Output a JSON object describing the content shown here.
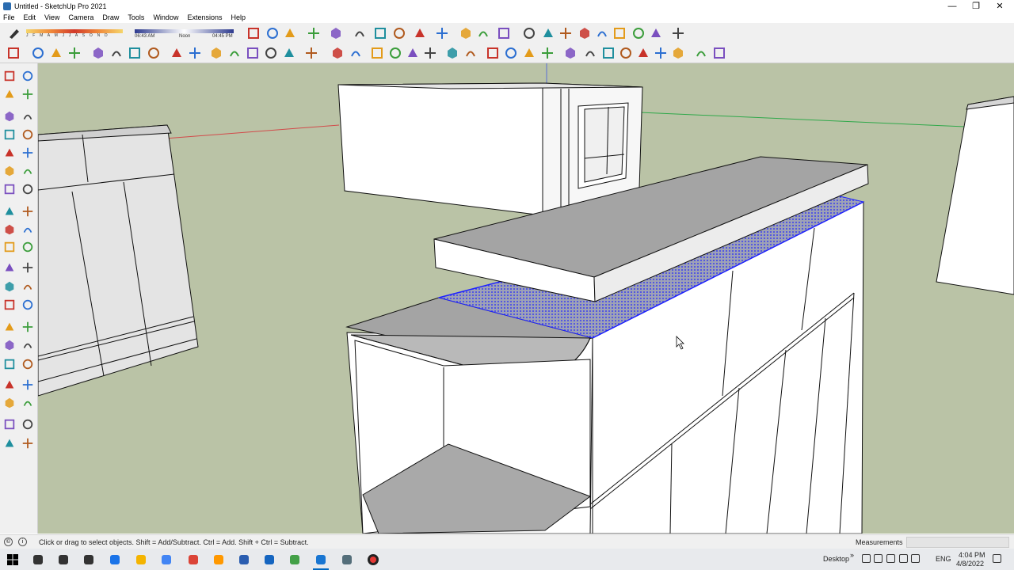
{
  "window": {
    "title": "Untitled - SketchUp Pro 2021",
    "minimize_glyph": "—",
    "maximize_glyph": "❐",
    "close_glyph": "✕"
  },
  "menu": [
    "File",
    "Edit",
    "View",
    "Camera",
    "Draw",
    "Tools",
    "Window",
    "Extensions",
    "Help"
  ],
  "shadow_settings": {
    "months": "J F M A M J J A S O N D",
    "time_start": "06:43 AM",
    "time_noon": "Noon",
    "time_end": "04:45 PM"
  },
  "status": {
    "hint": "Click or drag to select objects. Shift = Add/Subtract. Ctrl = Add. Shift + Ctrl = Subtract.",
    "measurements_label": "Measurements",
    "measurements_value": ""
  },
  "taskbar": {
    "desktop_label": "Desktop",
    "overflow_glyph": "»",
    "language": "ENG",
    "time": "4:04 PM",
    "date": "4/8/2022"
  },
  "colors": {
    "viewport_bg": "#bac3a6",
    "selection_blue": "#1e22ff",
    "face_gray": "#a4a4a4",
    "toolbar_bg": "#f0f0f0"
  },
  "icons": {
    "toolbar1": [
      "select-arrow-icon",
      "shadow-toggle-icon",
      "orbit-axes-icon",
      "dimension-icon",
      "protractor-icon",
      "style-icon",
      "section-cut-icon",
      "push-pull-icon",
      "move-icon",
      "rotate-icon",
      "follow-me-icon",
      "offset-icon",
      "scale-icon",
      "undo-icon",
      "redo-icon",
      "paint-icon",
      "photo-textures-icon",
      "location-icon",
      "sun-icon",
      "fog-icon",
      "dome-icon",
      "lock-icon",
      "map-icon"
    ],
    "toolbar2": [
      "extension-warehouse-icon",
      "component-icon",
      "group-icon",
      "solid-icon",
      "orbit-icon",
      "pan-icon",
      "zoom-icon",
      "zoom-extents-icon",
      "iso-view-icon",
      "top-view-icon",
      "front-view-icon",
      "right-view-icon",
      "back-view-icon",
      "left-view-icon",
      "wireframe-icon",
      "hidden-line-icon",
      "shaded-icon",
      "textured-icon",
      "monochrome-icon",
      "xray-icon",
      "outer-shell-icon",
      "intersect-icon",
      "union-icon",
      "subtract-icon",
      "trim-icon",
      "split-icon",
      "section-plane-icon",
      "section-fill-icon",
      "walk-icon",
      "look-around-icon",
      "position-camera-icon",
      "sandbox-icon",
      "terrain-icon",
      "stamp-icon",
      "drape-icon",
      "smoove-icon",
      "flip-edge-icon"
    ],
    "left": [
      "select-icon",
      "component-tool-icon",
      "paint-bucket-icon",
      "eraser-icon",
      "line-icon",
      "freehand-icon",
      "rectangle-icon",
      "rotated-rectangle-icon",
      "circle-icon",
      "polygon-icon",
      "arc-icon",
      "two-point-arc-icon",
      "three-point-arc-icon",
      "pie-icon",
      "move-tool-icon",
      "push-pull-tool-icon",
      "rotate-tool-icon",
      "follow-me-tool-icon",
      "scale-tool-icon",
      "offset-tool-icon",
      "tape-measure-icon",
      "text-tool-icon",
      "protractor-tool-icon",
      "axes-tool-icon",
      "dimension-tool-icon",
      "three-d-text-icon",
      "orbit-tool-icon",
      "pan-tool-icon",
      "zoom-tool-icon",
      "zoom-window-icon",
      "zoom-extents-tool-icon",
      "previous-view-icon",
      "position-camera-tool-icon",
      "look-around-tool-icon",
      "walk-tool-icon",
      "section-plane-tool-icon",
      "sandbox-from-contours-icon",
      "sandbox-from-scratch-icon",
      "smoove-tool-icon",
      "stamp-tool-icon"
    ]
  }
}
